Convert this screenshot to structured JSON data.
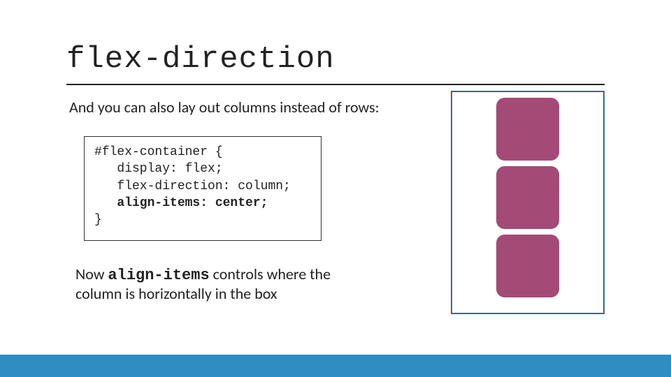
{
  "title": "flex-direction",
  "intro": "And you can also lay out columns instead of rows:",
  "code": {
    "line1": "#flex-container {",
    "line2": "   display: flex;",
    "line3": "   flex-direction: column;",
    "line4_prefix": "   ",
    "line4_bold": "align-items: center;",
    "line5": "}"
  },
  "paragraph": {
    "prefix": "Now ",
    "keyword": "align-items",
    "suffix": " controls where the column is horizontally in the box"
  },
  "demo": {
    "items": 3
  },
  "colors": {
    "accent_blue": "#2f8dc4",
    "border_blue": "#2d6aa0",
    "item_plum": "#a34a76"
  }
}
